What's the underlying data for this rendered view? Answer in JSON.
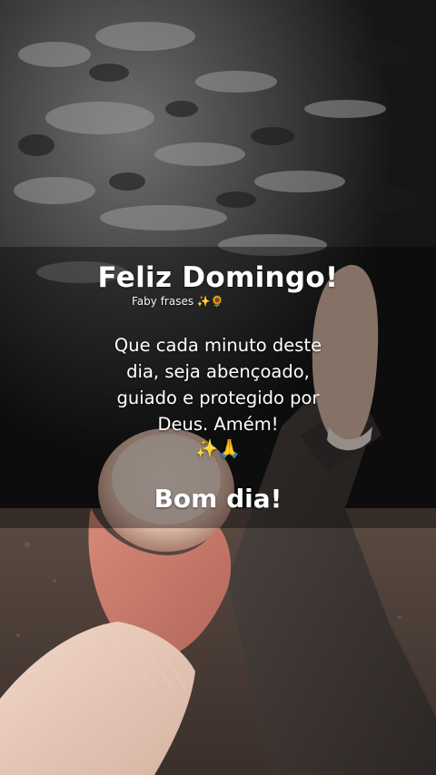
{
  "post": {
    "title": "Feliz Domingo!",
    "author_name": "Faby frases",
    "author_emoji_sparkles": "✨",
    "author_emoji_sunflower": "🌻",
    "message_lines": [
      "Que cada minuto deste",
      "dia, seja abençoado,",
      "guiado e protegido por",
      "Deus. Amém!"
    ],
    "message_emoji_sparkles": "✨",
    "message_emoji_pray": "🙏",
    "closing": "Bom dia!"
  },
  "colors": {
    "text": "#ffffff",
    "overlay": "rgba(0,0,0,0.38)",
    "sparkle": "#ffd94a"
  }
}
